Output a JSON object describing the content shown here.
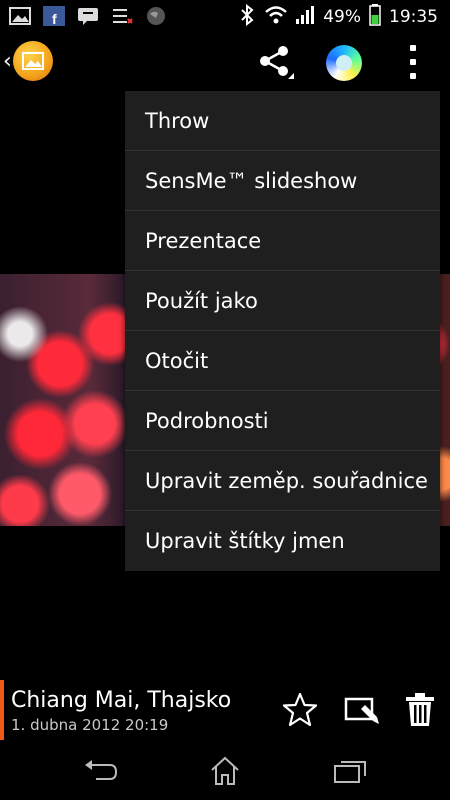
{
  "status_bar": {
    "battery": "49%",
    "time": "19:35",
    "icons": [
      "gallery-notification-icon",
      "facebook-notification-icon",
      "chat-notification-icon",
      "tasks-notification-icon",
      "globe-notification-icon",
      "bluetooth-icon",
      "wifi-icon",
      "signal-icon",
      "battery-icon"
    ]
  },
  "action_bar": {
    "icons": [
      "album-logo-icon",
      "share-icon",
      "sensme-icon",
      "overflow-menu-icon"
    ]
  },
  "menu": {
    "items": [
      {
        "label": "Throw"
      },
      {
        "label": "SensMe™ slideshow"
      },
      {
        "label": "Prezentace"
      },
      {
        "label": "Použít jako"
      },
      {
        "label": "Otočit"
      },
      {
        "label": "Podrobnosti"
      },
      {
        "label": "Upravit zeměp. souřadnice"
      },
      {
        "label": "Upravit štítky jmen"
      }
    ]
  },
  "photo_info": {
    "title": "Chiang Mai, Thajsko",
    "date": "1. dubna 2012 20:19",
    "accent_color": "#f25a1a"
  },
  "photo_actions": [
    "favorite-star-icon",
    "edit-icon",
    "delete-trash-icon"
  ],
  "nav_bar": [
    "back-icon",
    "home-icon",
    "recent-apps-icon"
  ]
}
